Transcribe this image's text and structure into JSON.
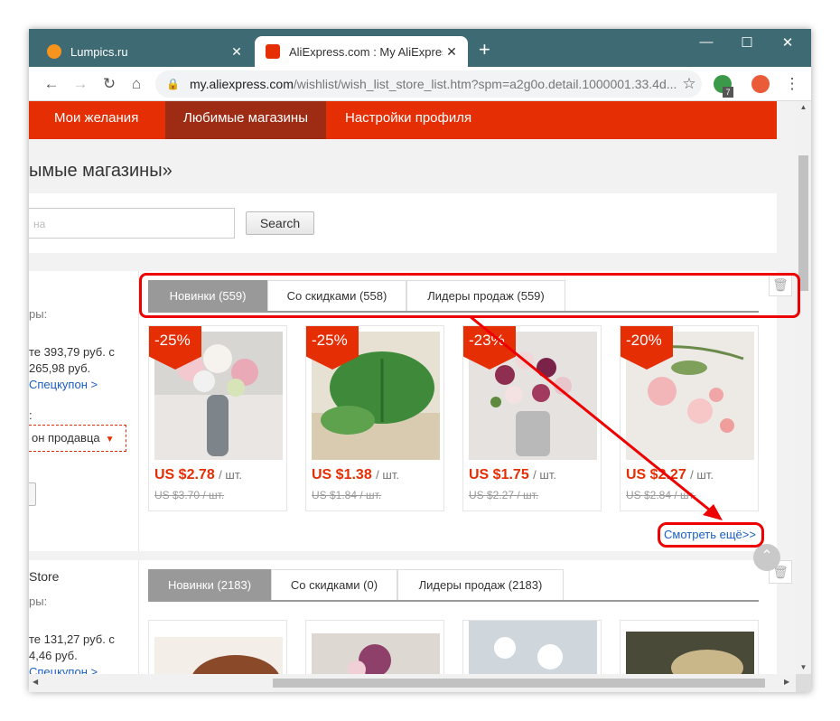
{
  "browser": {
    "tabs": [
      {
        "title": "Lumpics.ru",
        "close": "✕",
        "favicon_color": "#f7941d"
      },
      {
        "title": "AliExpress.com : My AliExpress",
        "close": "✕",
        "favicon_color": "#e62e04"
      }
    ],
    "new_tab": "+",
    "controls": {
      "minimize": "—",
      "maximize": "☐",
      "close": "✕"
    },
    "url_host": "my.aliexpress.com",
    "url_path": "/wishlist/wish_list_store_list.htm?spm=a2g0o.detail.1000001.33.4d...",
    "ext_badge": "7"
  },
  "nav": {
    "items": [
      "Мои желания",
      "Любимые магазины",
      "Настройки профиля"
    ],
    "selected": 1
  },
  "page": {
    "title": "ымые магазины»",
    "search_placeholder": "на",
    "search_button": "Search"
  },
  "stores": [
    {
      "info": {
        "line1": "ры:",
        "line2": "те 393,79 руб. с",
        "line3": "265,98 руб.",
        "link": "Спецкупон >",
        "label": ":",
        "coupon": "он продавца"
      },
      "tabs": [
        "Новинки (559)",
        "Со скидками (558)",
        "Лидеры продаж (559)"
      ],
      "products": [
        {
          "discount": "-25%",
          "price": "US $2.78",
          "unit": "/ шт.",
          "old": "US $3.70 / шт."
        },
        {
          "discount": "-25%",
          "price": "US $1.38",
          "unit": "/ шт.",
          "old": "US $1.84 / шт."
        },
        {
          "discount": "-23%",
          "price": "US $1.75",
          "unit": "/ шт.",
          "old": "US $2.27 / шт."
        },
        {
          "discount": "-20%",
          "price": "US $2.27",
          "unit": "/ шт.",
          "old": "US $2.84 / шт."
        }
      ],
      "more": "Смотреть ещё>>"
    },
    {
      "info": {
        "name": "Store",
        "line1": "ры:",
        "line2": "те 131,27 руб. с",
        "line3": "4,46 руб.",
        "link": "Спецкупон >"
      },
      "tabs": [
        "Новинки (2183)",
        "Со скидками (0)",
        "Лидеры продаж (2183)"
      ]
    }
  ],
  "colors": {
    "accent": "#e62e04",
    "annotation": "#ee0000",
    "titlebar": "#3e6a73"
  }
}
